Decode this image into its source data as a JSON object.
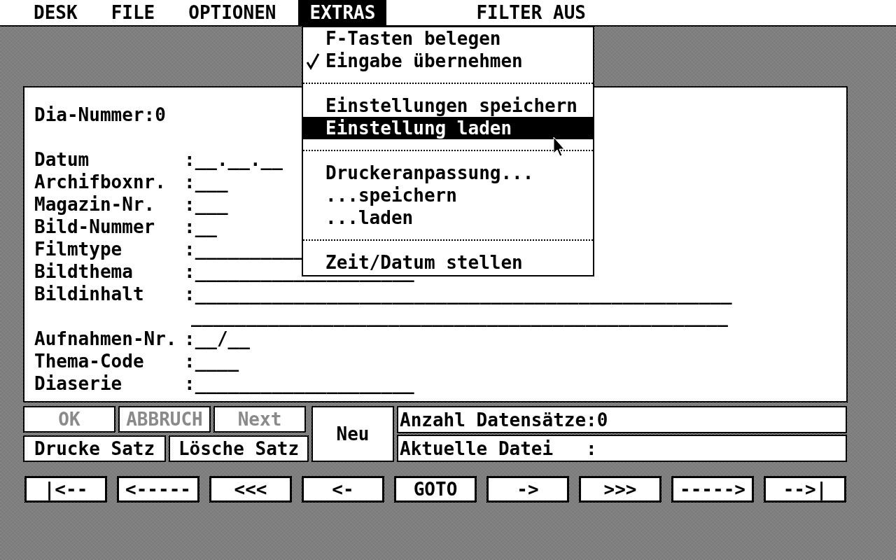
{
  "menu_bar": {
    "titles": [
      {
        "label": "DESK",
        "selected": false
      },
      {
        "label": "FILE",
        "selected": false
      },
      {
        "label": "OPTIONEN",
        "selected": false
      },
      {
        "label": "EXTRAS",
        "selected": true
      }
    ],
    "filter_status": "FILTER AUS"
  },
  "dropdown": {
    "items": [
      {
        "kind": "item",
        "label": "F-Tasten belegen",
        "checked": false,
        "selected": false
      },
      {
        "kind": "item",
        "label": "Eingabe übernehmen",
        "checked": true,
        "selected": false
      },
      {
        "kind": "separator"
      },
      {
        "kind": "item",
        "label": "Einstellungen speichern",
        "checked": false,
        "selected": false
      },
      {
        "kind": "item",
        "label": "Einstellung laden",
        "checked": false,
        "selected": true
      },
      {
        "kind": "separator"
      },
      {
        "kind": "item",
        "label": "Druckeranpassung...",
        "checked": false,
        "selected": false
      },
      {
        "kind": "item",
        "label": "...speichern",
        "checked": false,
        "selected": false
      },
      {
        "kind": "item",
        "label": "...laden",
        "checked": false,
        "selected": false
      },
      {
        "kind": "separator"
      },
      {
        "kind": "item",
        "label": "Zeit/Datum stellen",
        "checked": false,
        "selected": false
      }
    ]
  },
  "form": {
    "header": "Dia-Nummer:0",
    "fields": [
      {
        "label": "Datum",
        "lines": [
          ":__.__.__"
        ]
      },
      {
        "label": "Archifboxnr.",
        "lines": [
          ":___"
        ]
      },
      {
        "label": "Magazin-Nr.",
        "lines": [
          ":___"
        ]
      },
      {
        "label": "Bild-Nummer",
        "lines": [
          ":__"
        ]
      },
      {
        "label": "Filmtype",
        "lines": [
          ":__________"
        ]
      },
      {
        "label": "Bildthema",
        "lines": [
          ":____________________"
        ]
      },
      {
        "label": "Bildinhalt",
        "lines": [
          ":_________________________________________________",
          "_________________________________________________"
        ]
      },
      {
        "label": "Aufnahmen-Nr.",
        "lines": [
          ":__/__"
        ]
      },
      {
        "label": "Thema-Code",
        "lines": [
          ":____"
        ]
      },
      {
        "label": "Diaserie",
        "lines": [
          ":____________________"
        ]
      }
    ]
  },
  "action_buttons": {
    "row_1": [
      {
        "label": "OK",
        "disabled": true
      },
      {
        "label": "ABBRUCH",
        "disabled": true
      },
      {
        "label": "Next",
        "disabled": true
      }
    ],
    "row_2": [
      {
        "label": "Drucke Satz",
        "disabled": false
      },
      {
        "label": "Lösche Satz",
        "disabled": false
      }
    ],
    "new_button": {
      "label": "Neu",
      "disabled": false
    }
  },
  "info": [
    "Anzahl Datensätze:0",
    "Aktuelle Datei   :"
  ],
  "navigation": [
    "|<--",
    "<-----",
    "<<<",
    "<-",
    "GOTO",
    "->",
    ">>>",
    "----->",
    "-->|"
  ]
}
